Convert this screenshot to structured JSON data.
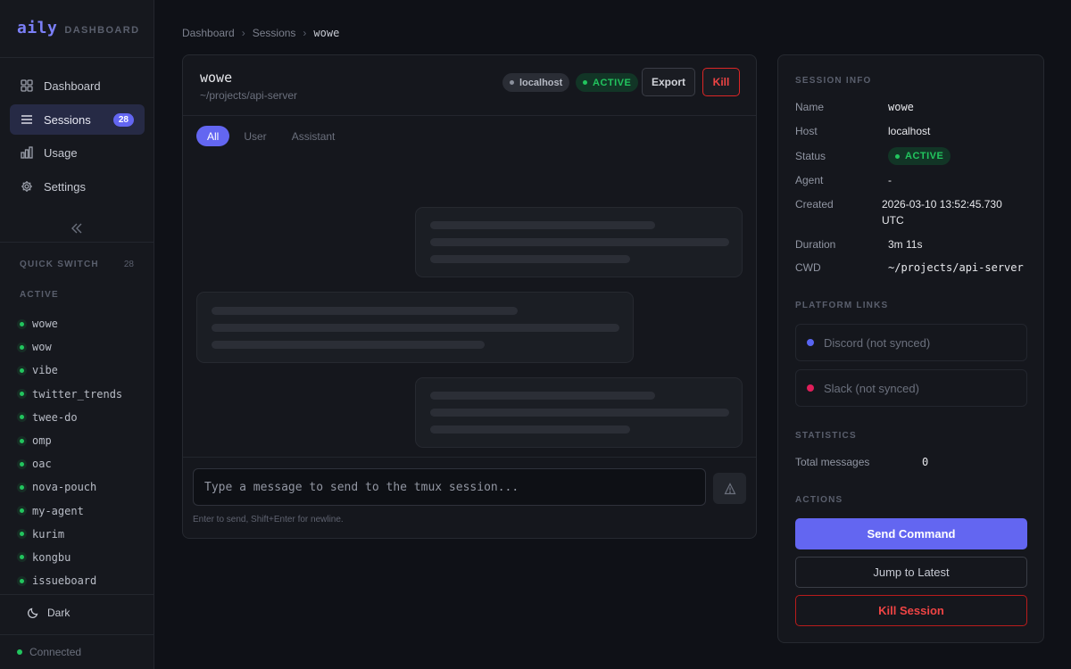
{
  "brand": {
    "logo": "aily",
    "subtitle": "DASHBOARD"
  },
  "nav": {
    "items": [
      {
        "label": "Dashboard",
        "icon": "grid-icon"
      },
      {
        "label": "Sessions",
        "icon": "list-icon",
        "badge": "28"
      },
      {
        "label": "Usage",
        "icon": "bar-chart-icon"
      },
      {
        "label": "Settings",
        "icon": "gear-icon"
      }
    ]
  },
  "quick_switch": {
    "label": "QUICK SWITCH",
    "count": "28",
    "group_label": "ACTIVE",
    "items": [
      "wowe",
      "wow",
      "vibe",
      "twitter_trends",
      "twee-do",
      "omp",
      "oac",
      "nova-pouch",
      "my-agent",
      "kurim",
      "kongbu",
      "issueboard"
    ]
  },
  "theme": {
    "label": "Dark"
  },
  "connection": {
    "label": "Connected"
  },
  "breadcrumb": {
    "items": [
      "Dashboard",
      "Sessions",
      "wowe"
    ],
    "separator": "›"
  },
  "session": {
    "title": "wowe",
    "path": "~/projects/api-server",
    "host_chip": "localhost",
    "status_chip": "ACTIVE",
    "export_label": "Export",
    "kill_label": "Kill"
  },
  "filters": [
    "All",
    "User",
    "Assistant"
  ],
  "composer": {
    "placeholder": "Type a message to send to the tmux session...",
    "hint": "Enter to send, Shift+Enter for newline."
  },
  "info": {
    "section_title": "SESSION INFO",
    "name_label": "Name",
    "name_value": "wowe",
    "host_label": "Host",
    "host_value": "localhost",
    "status_label": "Status",
    "status_value": "ACTIVE",
    "agent_label": "Agent",
    "agent_value": "-",
    "created_label": "Created",
    "created_value_1": "2026-03-10 13:52:45.730",
    "created_value_2": "UTC",
    "duration_label": "Duration",
    "duration_value": "3m 11s",
    "cwd_label": "CWD",
    "cwd_value": "~/projects/api-server"
  },
  "platform_links": {
    "title": "PLATFORM LINKS",
    "discord": "Discord (not synced)",
    "slack": "Slack (not synced)"
  },
  "statistics": {
    "title": "STATISTICS",
    "total_label": "Total messages",
    "total_value": "0"
  },
  "actions": {
    "title": "ACTIONS",
    "send": "Send Command",
    "jump": "Jump to Latest",
    "kill": "Kill Session"
  },
  "colors": {
    "accent": "#6366f1",
    "active_green": "#22c55e",
    "danger": "#ef4444",
    "discord": "#5865f2",
    "slack": "#e01e5a"
  }
}
